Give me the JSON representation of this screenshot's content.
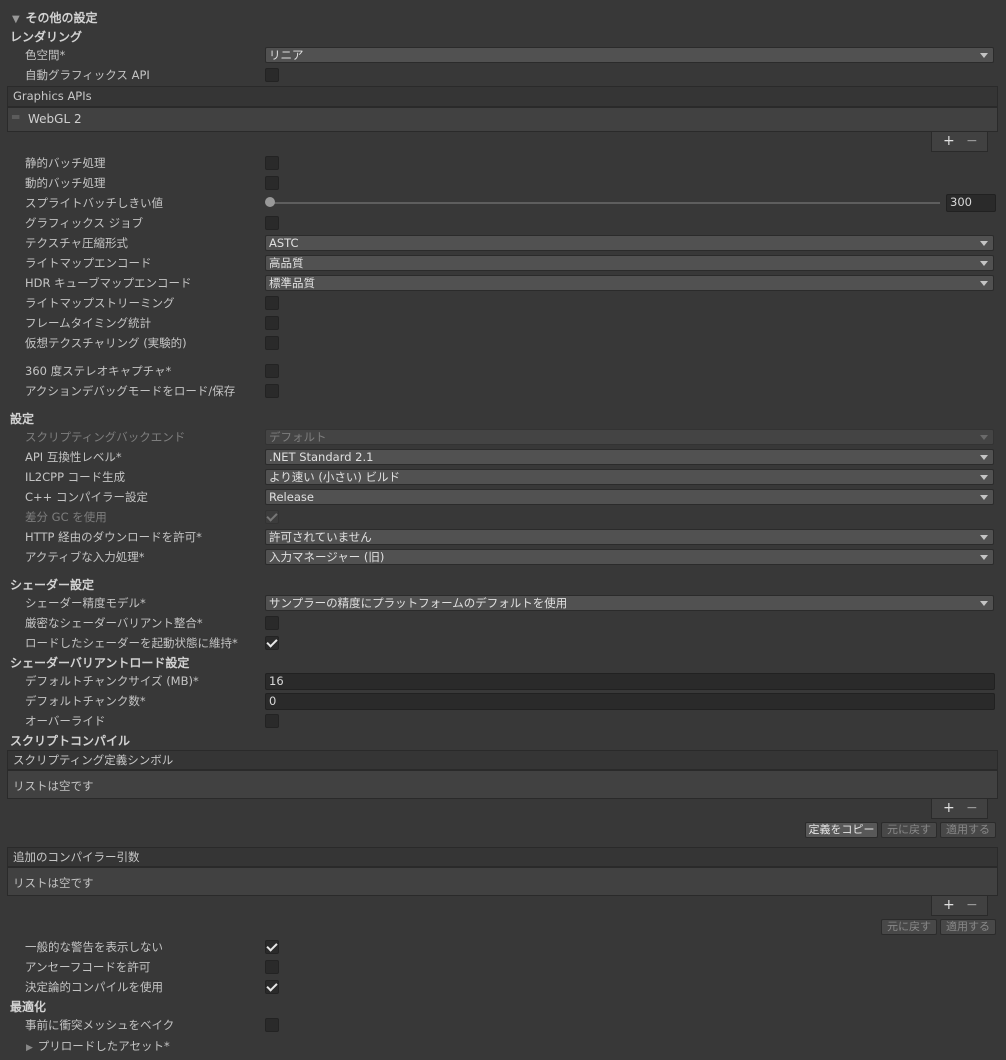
{
  "section_title": "その他の設定",
  "rendering": {
    "header": "レンダリング",
    "color_space_label": "色空間*",
    "color_space_value": "リニア",
    "auto_graphics_api_label": "自動グラフィックス API",
    "graphics_apis_header": "Graphics APIs",
    "graphics_api_item": "WebGL 2",
    "add_symbol": "+",
    "remove_symbol": "−",
    "static_batching_label": "静的バッチ処理",
    "dynamic_batching_label": "動的バッチ処理",
    "sprite_batch_threshold_label": "スプライトバッチしきい値",
    "sprite_batch_threshold_value": "300",
    "graphics_jobs_label": "グラフィックス ジョブ",
    "texture_compression_label": "テクスチャ圧縮形式",
    "texture_compression_value": "ASTC",
    "lightmap_encoding_label": "ライトマップエンコード",
    "lightmap_encoding_value": "高品質",
    "hdr_cubemap_label": "HDR キューブマップエンコード",
    "hdr_cubemap_value": "標準品質",
    "lightmap_streaming_label": "ライトマップストリーミング",
    "frame_timing_label": "フレームタイミング統計",
    "virtual_texturing_label": "仮想テクスチャリング (実験的)",
    "stereo_capture_label": "360 度ステレオキャプチャ*",
    "action_debug_label": "アクションデバッグモードをロード/保存"
  },
  "config": {
    "header": "設定",
    "scripting_backend_label": "スクリプティングバックエンド",
    "scripting_backend_value": "デフォルト",
    "api_level_label": "API 互換性レベル*",
    "api_level_value": ".NET Standard 2.1",
    "il2cpp_label": "IL2CPP コード生成",
    "il2cpp_value": "より速い (小さい) ビルド",
    "cpp_compiler_label": "C++ コンパイラー設定",
    "cpp_compiler_value": "Release",
    "incremental_gc_label": "差分 GC を使用",
    "http_label": "HTTP 経由のダウンロードを許可*",
    "http_value": "許可されていません",
    "input_label": "アクティブな入力処理*",
    "input_value": "入力マネージャー (旧)"
  },
  "shader": {
    "header": "シェーダー設定",
    "precision_label": "シェーダー精度モデル*",
    "precision_value": "サンプラーの精度にプラットフォームのデフォルトを使用",
    "strict_label": "厳密なシェーダーバリアント整合*",
    "keep_loaded_label": "ロードしたシェーダーを起動状態に維持*"
  },
  "variant_load": {
    "header": "シェーダーバリアントロード設定",
    "chunk_size_label": "デフォルトチャンクサイズ (MB)*",
    "chunk_size_value": "16",
    "chunk_count_label": "デフォルトチャンク数*",
    "chunk_count_value": "0",
    "override_label": "オーバーライド"
  },
  "script_compile": {
    "header": "スクリプトコンパイル",
    "define_symbols_header": "スクリプティング定義シンボル",
    "empty_list": "リストは空です",
    "copy_defines": "定義をコピー",
    "revert": "元に戻す",
    "apply": "適用する",
    "compiler_args_header": "追加のコンパイラー引数",
    "empty_list2": "リストは空です",
    "revert2": "元に戻す",
    "apply2": "適用する",
    "suppress_warnings_label": "一般的な警告を表示しない",
    "unsafe_label": "アンセーフコードを許可",
    "deterministic_label": "決定論的コンパイルを使用"
  },
  "optimization": {
    "header": "最適化",
    "bake_collision_label": "事前に衝突メッシュをベイク",
    "preloaded_assets_label": "プリロードしたアセット*"
  }
}
